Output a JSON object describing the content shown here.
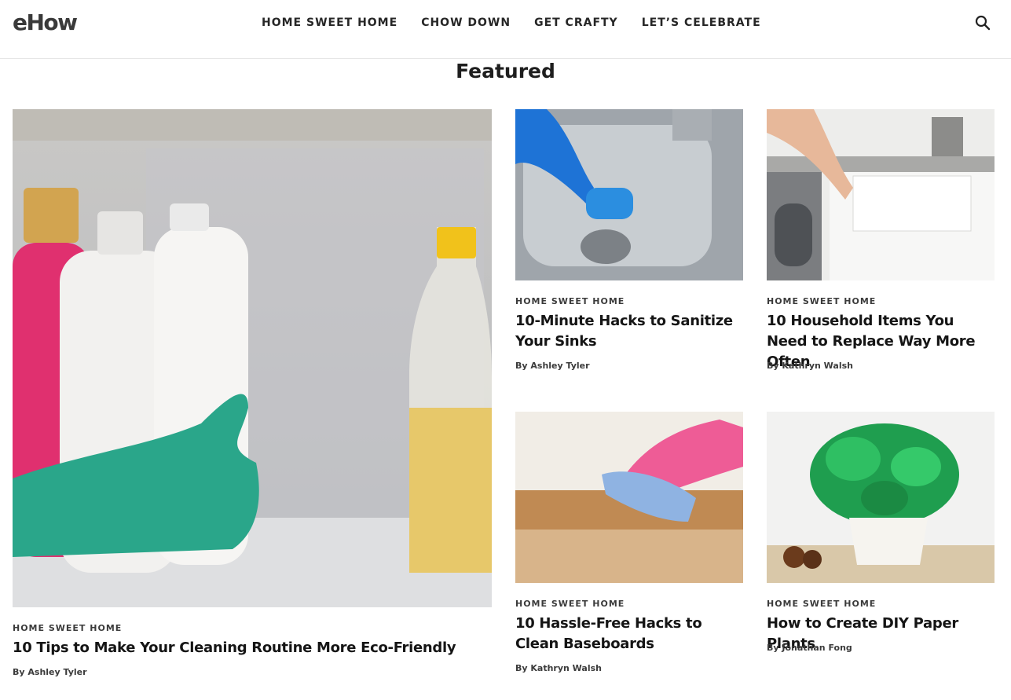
{
  "site": {
    "logo": "eHow"
  },
  "nav": {
    "items": [
      {
        "label": "HOME SWEET HOME"
      },
      {
        "label": "CHOW DOWN"
      },
      {
        "label": "GET CRAFTY"
      },
      {
        "label": "LET’S CELEBRATE"
      }
    ]
  },
  "featured": {
    "heading": "Featured",
    "articles": [
      {
        "category": "HOME SWEET HOME",
        "title": "10 Tips to Make Your Cleaning Routine More Eco-Friendly",
        "author": "By Ashley Tyler"
      },
      {
        "category": "HOME SWEET HOME",
        "title": "10-Minute Hacks to Sanitize Your Sinks",
        "author": "By Ashley Tyler"
      },
      {
        "category": "HOME SWEET HOME",
        "title": "10 Household Items You Need to Replace Way More Often",
        "author": "By Kathryn Walsh"
      },
      {
        "category": "HOME SWEET HOME",
        "title": "10 Hassle-Free Hacks to Clean Baseboards",
        "author": "By Kathryn Walsh"
      },
      {
        "category": "HOME SWEET HOME",
        "title": "How to Create DIY Paper Plants",
        "author": "By Jonathan Fong"
      }
    ]
  }
}
